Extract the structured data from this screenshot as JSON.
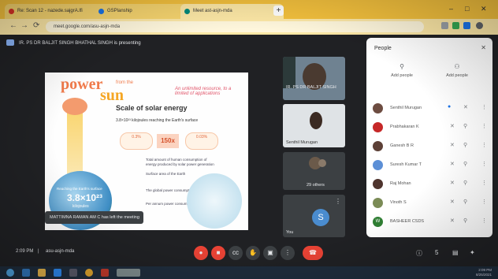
{
  "browser": {
    "tabs": [
      {
        "title": "Re: Scan 12 - nazede.sajgrA.lfi",
        "favicon_color": "#d93025"
      },
      {
        "title": "GSPlanship",
        "favicon_color": "#1a73e8"
      },
      {
        "title": "Meet ast-asjn-mda",
        "favicon_color": "#00897b"
      }
    ],
    "new_tab_label": "+",
    "url": "meet.google.com/asu-asjn-mda"
  },
  "meeting": {
    "presenting_text": "IR. PS DR BALJIT SINGH BHATHAL SINGH is presenting",
    "toast": "MATTIMNA RAMAN AM C has left the meeting",
    "time": "2:09 PM",
    "code": "asu-asjn-mda",
    "controls": {
      "mic": "●",
      "camera": "■",
      "captions": "cc",
      "raise_hand": "✋",
      "present": "▣",
      "more": "⋮",
      "hangup": "☎"
    },
    "right_controls": {
      "info": "ⓘ",
      "people_count": "5",
      "chat": "▤",
      "activities": "✦"
    }
  },
  "slide": {
    "power": "power",
    "from_the": "from the",
    "sun": "sun",
    "tagline": "An unlimited resource, to a limited of applications",
    "scale_title": "Scale of solar energy",
    "line1": "3.8×10²³ kilojoules reaching the Earth's surface",
    "bubble1": "0.3%",
    "box150": "150x",
    "bubble2": "0.03%",
    "body1": "Total amount of human consumption of energy produced by solar power generation",
    "body2": "Surface area of the Earth",
    "body3": "The global power consumption",
    "body4": "Per annum power consumption",
    "earth_reach": "Reaching the Earth's surface",
    "big_value": "3.8×10²³",
    "big_unit": "kilojoules"
  },
  "tiles": [
    {
      "name": "IR. PS DR BALJIT SINGH"
    },
    {
      "name": "Senthil Murugan"
    },
    {
      "name": "29 others"
    },
    {
      "name": "You",
      "initial": "S"
    }
  ],
  "people_panel": {
    "title": "People",
    "tab1": "Add people",
    "tab2": "Add people",
    "participants": [
      {
        "name": "Senthil Murugan",
        "color": "#6d4c41"
      },
      {
        "name": "Prabhakaran K",
        "color": "#c62828"
      },
      {
        "name": "Ganesh B R",
        "color": "#5d4037"
      },
      {
        "name": "Suresh Kumar T",
        "color": "#5c8fd6"
      },
      {
        "name": "Raj Mohan",
        "color": "#4e342e"
      },
      {
        "name": "Vinoth S",
        "color": "#7b8b56"
      },
      {
        "name": "BASHEER CSDS",
        "color": "#2e7d32",
        "initial": "W"
      }
    ],
    "icons": {
      "pin": "⚓",
      "mute": "✕",
      "more": "⋮"
    }
  },
  "taskbar": {
    "clock_time": "2:09 PM",
    "clock_date": "8/25/2021"
  },
  "colors": {
    "tabstrip": "#f4c13d",
    "meet_bg": "#202124",
    "hangup": "#ea4335"
  }
}
